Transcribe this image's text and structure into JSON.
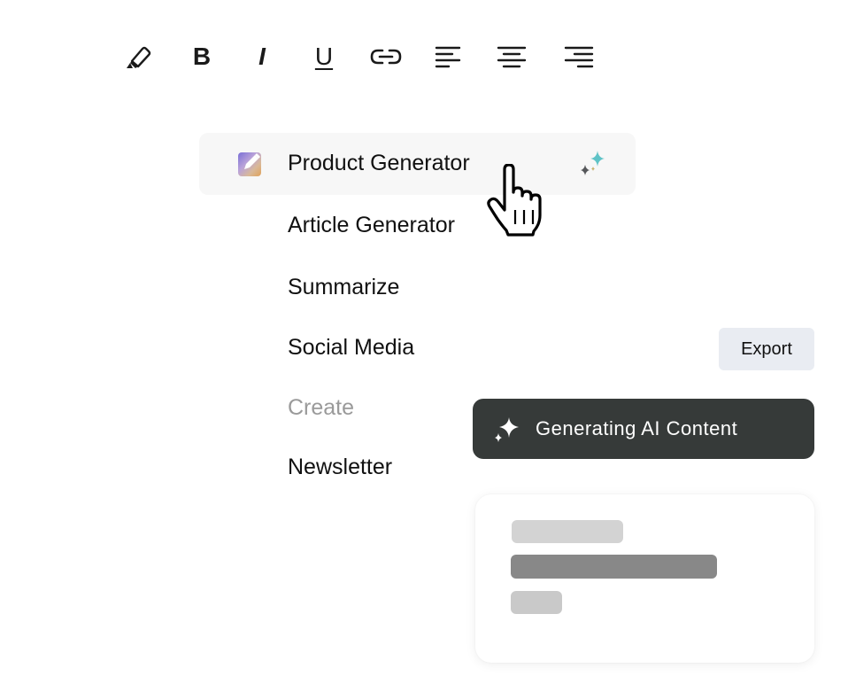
{
  "toolbar": {
    "tools": [
      {
        "name": "highlighter-icon"
      },
      {
        "name": "bold",
        "glyph": "B"
      },
      {
        "name": "italic",
        "glyph": "I"
      },
      {
        "name": "underline",
        "glyph": "U"
      },
      {
        "name": "link-icon"
      },
      {
        "name": "align-left-icon"
      },
      {
        "name": "align-center-icon"
      },
      {
        "name": "align-right-icon"
      }
    ]
  },
  "menu": {
    "items": [
      {
        "label": "Product Generator",
        "state": "hovered"
      },
      {
        "label": "Article Generator"
      },
      {
        "label": "Summarize"
      },
      {
        "label": "Social Media"
      },
      {
        "label": "Create",
        "state": "muted"
      },
      {
        "label": "Newsletter"
      }
    ]
  },
  "export_button": {
    "label": "Export"
  },
  "generating": {
    "label": "Generating AI Content"
  },
  "colors": {
    "pill_background": "#363a39",
    "export_background": "#e9ecf2",
    "hover_background": "#f7f7f7",
    "muted_text": "#9a9a9a",
    "sparkle_teal": "#5fc3c7"
  },
  "icons": {
    "edit": "edit-icon",
    "sparkle": "sparkle-icon",
    "cursor": "hand-pointer-icon"
  }
}
